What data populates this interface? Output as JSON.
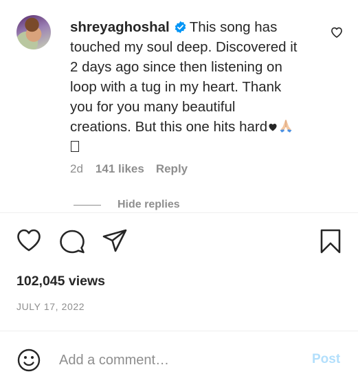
{
  "comment": {
    "username": "shreyaghoshal",
    "text_lines": [
      "This song has",
      "touched my soul deep. Discovered it",
      "2 days ago since then listening on",
      "loop with a tug in my heart. Thank",
      "you for you many beautiful",
      "creations. But this one hits hard"
    ],
    "emoji_icons": [
      "black-heart-icon",
      "folded-hands-icon",
      "unsupported-glyph-box-icon"
    ],
    "age": "2d",
    "likes": "141 likes",
    "reply_label": "Reply",
    "hide_replies_label": "Hide replies"
  },
  "post": {
    "views": "102,045 views",
    "date": "JULY 17, 2022"
  },
  "add_comment": {
    "placeholder": "Add a comment…",
    "post_label": "Post"
  },
  "colors": {
    "text": "#262626",
    "secondary": "#8e8e8e",
    "verified_blue": "#0095f6",
    "post_disabled": "#b2dffc",
    "divider": "#efefef"
  }
}
